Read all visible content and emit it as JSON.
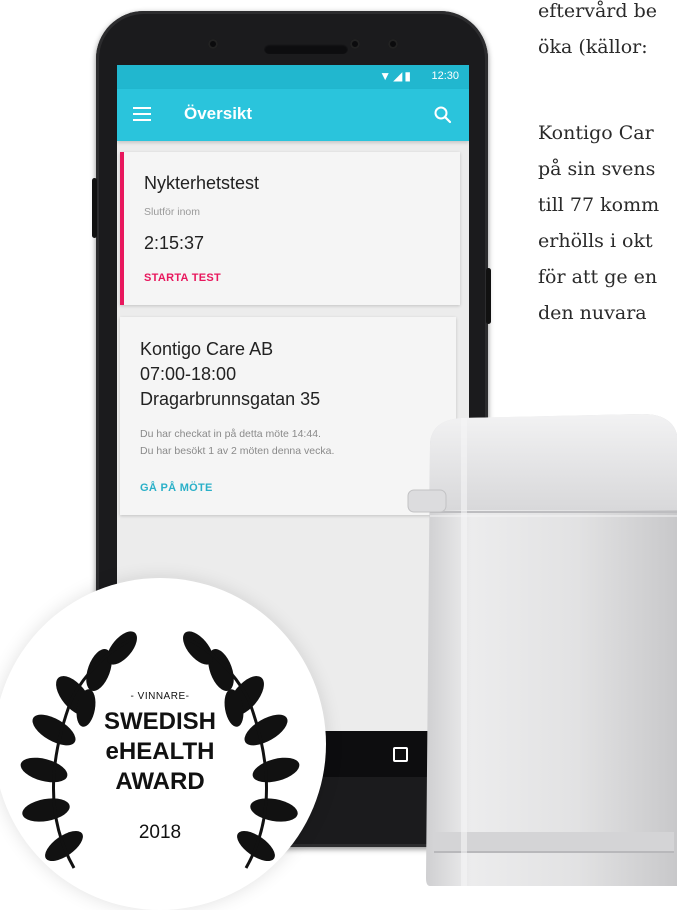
{
  "article": {
    "lines": [
      "eftervård be",
      "öka (källor:",
      "Kontigo Car",
      "på sin svens",
      "till 77 komm",
      "erhölls i okt",
      "för att ge en",
      "den nuvara"
    ]
  },
  "statusbar": {
    "time": "12:30",
    "icons": "▼◢▮"
  },
  "appbar": {
    "title": "Översikt"
  },
  "card_test": {
    "title": "Nykterhetstest",
    "subtitle": "Slutför inom",
    "countdown": "2:15:37",
    "action": "STARTA TEST"
  },
  "card_meeting": {
    "name": "Kontigo Care AB",
    "hours": "07:00-18:00",
    "address": "Dragarbrunnsgatan 35",
    "info1": "Du har checkat in på detta möte 14:44.",
    "info2": "Du har besökt 1 av 2 möten denna vecka.",
    "action": "GÅ PÅ MÖTE"
  },
  "award": {
    "label": "- VINNARE-",
    "line1": "SWEDISH",
    "line2": "eHEALTH",
    "line3": "AWARD",
    "year": "2018"
  },
  "colors": {
    "accent": "#2ac4dc",
    "status": "#21b7cf",
    "alert": "#e8175d",
    "link": "#2ab0c8"
  }
}
